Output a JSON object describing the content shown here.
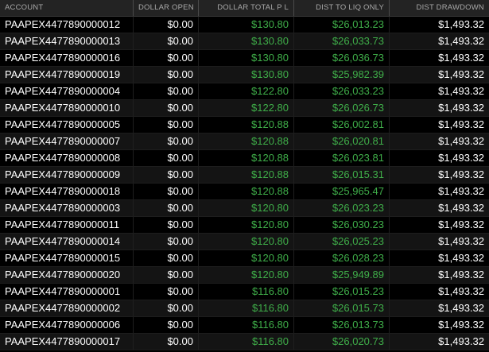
{
  "columns": [
    "ACCOUNT",
    "DOLLAR OPEN",
    "DOLLAR TOTAL P L",
    "DIST TO LIQ ONLY",
    "DIST DRAWDOWN"
  ],
  "colors": {
    "positive": "#3fae49",
    "text": "#ffffff",
    "header_text": "#a8a8a8",
    "header_bg": "#232323",
    "row_alt_bg": "#141414"
  },
  "rows": [
    [
      "PAAPEX4477890000012",
      "$0.00",
      "$130.80",
      "$26,013.23",
      "$1,493.32"
    ],
    [
      "PAAPEX4477890000013",
      "$0.00",
      "$130.80",
      "$26,033.73",
      "$1,493.32"
    ],
    [
      "PAAPEX4477890000016",
      "$0.00",
      "$130.80",
      "$26,036.73",
      "$1,493.32"
    ],
    [
      "PAAPEX4477890000019",
      "$0.00",
      "$130.80",
      "$25,982.39",
      "$1,493.32"
    ],
    [
      "PAAPEX4477890000004",
      "$0.00",
      "$122.80",
      "$26,033.23",
      "$1,493.32"
    ],
    [
      "PAAPEX4477890000010",
      "$0.00",
      "$122.80",
      "$26,026.73",
      "$1,493.32"
    ],
    [
      "PAAPEX4477890000005",
      "$0.00",
      "$120.88",
      "$26,002.81",
      "$1,493.32"
    ],
    [
      "PAAPEX4477890000007",
      "$0.00",
      "$120.88",
      "$26,020.81",
      "$1,493.32"
    ],
    [
      "PAAPEX4477890000008",
      "$0.00",
      "$120.88",
      "$26,023.81",
      "$1,493.32"
    ],
    [
      "PAAPEX4477890000009",
      "$0.00",
      "$120.88",
      "$26,015.31",
      "$1,493.32"
    ],
    [
      "PAAPEX4477890000018",
      "$0.00",
      "$120.88",
      "$25,965.47",
      "$1,493.32"
    ],
    [
      "PAAPEX4477890000003",
      "$0.00",
      "$120.80",
      "$26,023.23",
      "$1,493.32"
    ],
    [
      "PAAPEX4477890000011",
      "$0.00",
      "$120.80",
      "$26,030.23",
      "$1,493.32"
    ],
    [
      "PAAPEX4477890000014",
      "$0.00",
      "$120.80",
      "$26,025.23",
      "$1,493.32"
    ],
    [
      "PAAPEX4477890000015",
      "$0.00",
      "$120.80",
      "$26,028.23",
      "$1,493.32"
    ],
    [
      "PAAPEX4477890000020",
      "$0.00",
      "$120.80",
      "$25,949.89",
      "$1,493.32"
    ],
    [
      "PAAPEX4477890000001",
      "$0.00",
      "$116.80",
      "$26,015.23",
      "$1,493.32"
    ],
    [
      "PAAPEX4477890000002",
      "$0.00",
      "$116.80",
      "$26,015.73",
      "$1,493.32"
    ],
    [
      "PAAPEX4477890000006",
      "$0.00",
      "$116.80",
      "$26,013.73",
      "$1,493.32"
    ],
    [
      "PAAPEX4477890000017",
      "$0.00",
      "$116.80",
      "$26,020.73",
      "$1,493.32"
    ]
  ]
}
